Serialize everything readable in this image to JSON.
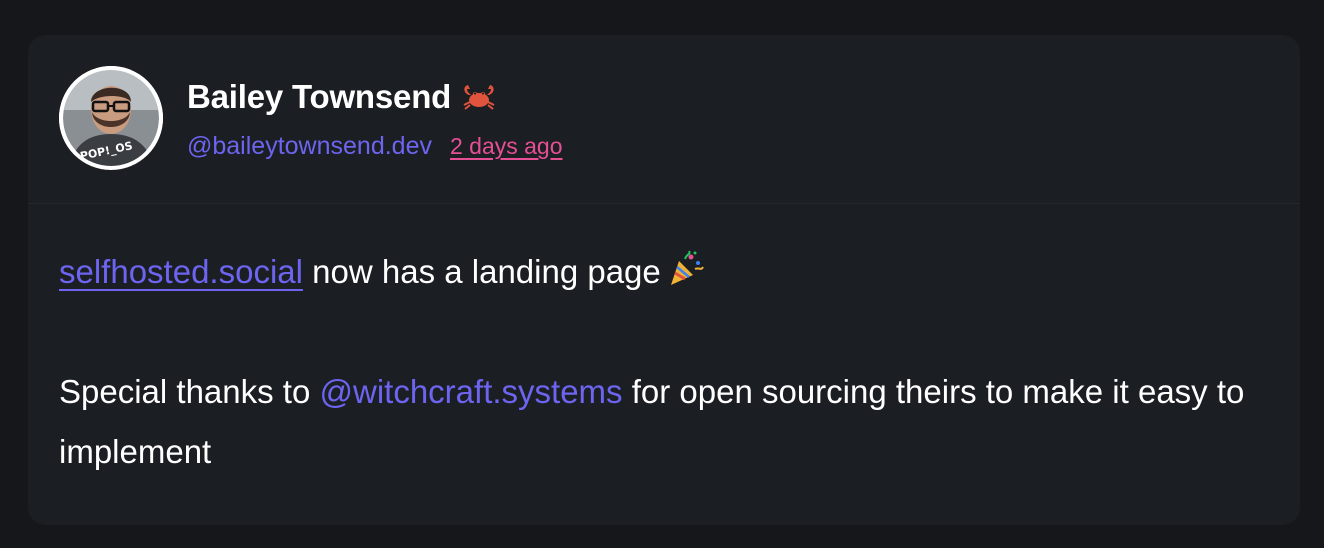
{
  "post": {
    "author": {
      "display_name": "Bailey Townsend",
      "name_emoji_icon": "crab-icon",
      "handle": "@baileytownsend.dev",
      "avatar_shirt_text": "POP!_OS"
    },
    "timestamp": "2 days ago",
    "body": {
      "link_text": "selfhosted.social",
      "line1_text": " now has a landing page",
      "line1_emoji_icon": "party-popper-icon",
      "line2_prefix": "Special thanks to ",
      "mention": "@witchcraft.systems",
      "line2_suffix": " for open sourcing theirs to make it easy to implement"
    }
  },
  "colors": {
    "page_background": "#15171b",
    "card_background": "#1b1e23",
    "accent": "#6d64f0",
    "timestamp": "#e64f94",
    "text": "#ffffff"
  }
}
